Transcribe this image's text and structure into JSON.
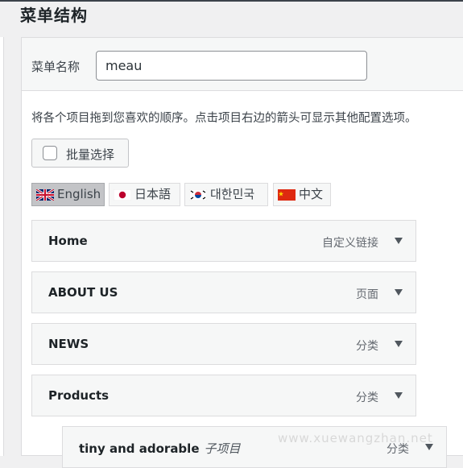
{
  "page": {
    "heading": "菜单结构"
  },
  "menu": {
    "name_label": "菜单名称",
    "name_value": "meau",
    "instructions": "将各个项目拖到您喜欢的顺序。点击项目右边的箭头可显示其他配置选项。",
    "bulk_select_label": "批量选择",
    "bulk_select_checked": false
  },
  "languages": [
    {
      "label": "English",
      "flag": "uk-flag-icon",
      "active": true
    },
    {
      "label": "日本語",
      "flag": "japan-flag-icon",
      "active": false
    },
    {
      "label": "대한민국",
      "flag": "korea-flag-icon",
      "active": false
    },
    {
      "label": "中文",
      "flag": "china-flag-icon",
      "active": false
    }
  ],
  "items": [
    {
      "title": "Home",
      "type": "自定义链接"
    },
    {
      "title": "ABOUT US",
      "type": "页面"
    },
    {
      "title": "NEWS",
      "type": "分类"
    },
    {
      "title": "Products",
      "type": "分类"
    },
    {
      "title": "tiny and adorable",
      "subtitle": "子项目",
      "type": "分类"
    }
  ],
  "watermark": "www.xuewangzhan.net"
}
